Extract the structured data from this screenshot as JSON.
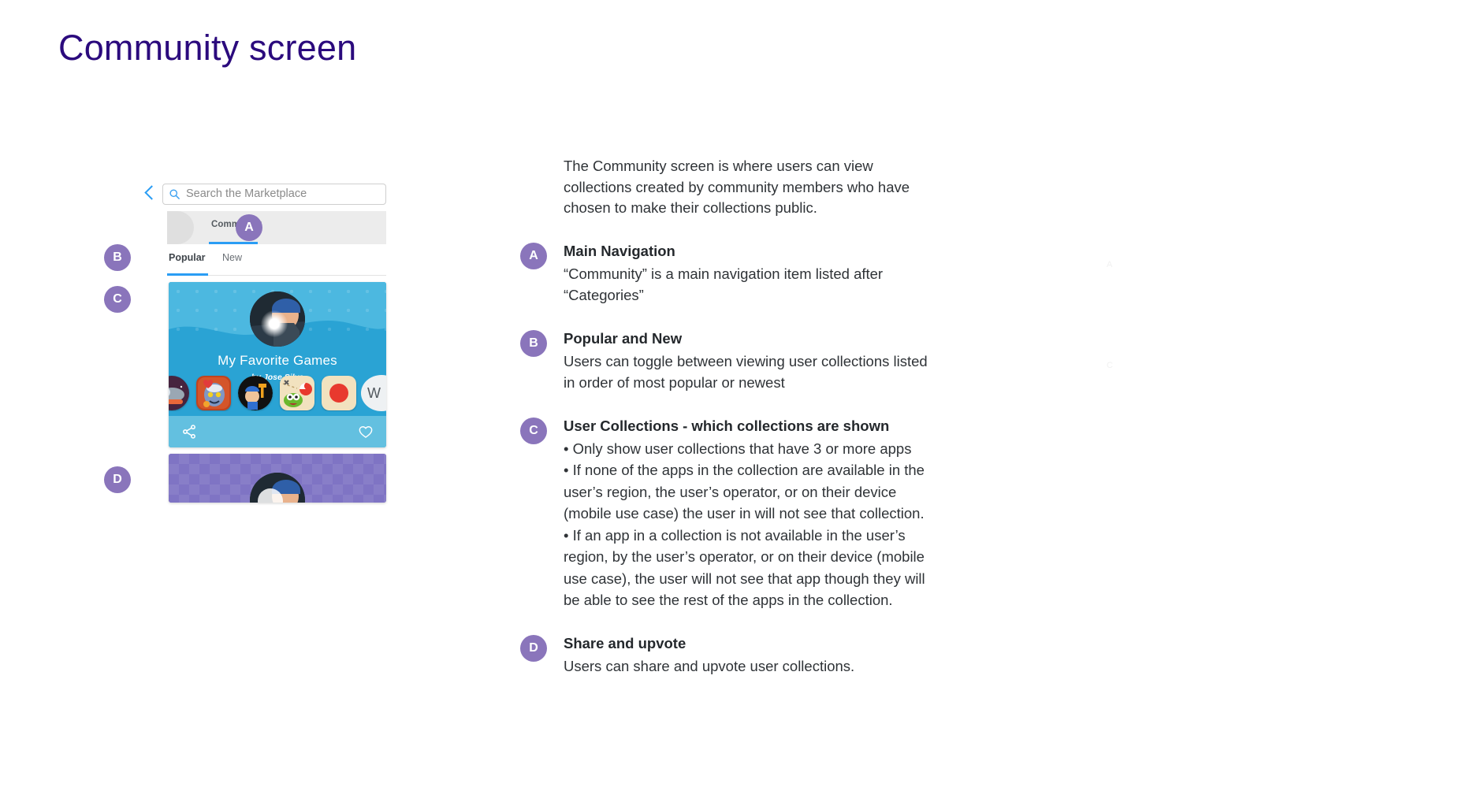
{
  "page": {
    "title": "Community screen",
    "title_color": "#2b0a7d"
  },
  "theme": {
    "badge_purple": "#8a75bb",
    "accent_blue": "#2a9df4",
    "card_blue": "#4cb8e0",
    "card_action_blue": "#63c0e0",
    "card_purple": "#7f74c4",
    "body_text": "#2f3337"
  },
  "mock": {
    "search": {
      "placeholder": "Search the Marketplace",
      "back_icon": "back-chevron-icon",
      "icon": "search-icon"
    },
    "main_nav": {
      "active_item": "Community",
      "items": [
        "Community"
      ]
    },
    "subtabs": [
      {
        "label": "Popular",
        "active": true
      },
      {
        "label": "New",
        "active": false
      }
    ],
    "collections": [
      {
        "title": "My Favorite Games",
        "byline": "by Jose Silva",
        "more_label": "W",
        "actions": {
          "share_icon": "share-icon",
          "upvote_icon": "heart-icon"
        },
        "apps": [
          {
            "name": "app-icon-1"
          },
          {
            "name": "app-icon-2"
          },
          {
            "name": "app-icon-3"
          },
          {
            "name": "app-icon-4"
          },
          {
            "name": "app-icon-5"
          }
        ]
      },
      {
        "title": "",
        "byline": ""
      }
    ],
    "badges": [
      {
        "letter": "A"
      },
      {
        "letter": "B"
      },
      {
        "letter": "C"
      },
      {
        "letter": "D"
      }
    ]
  },
  "notes": {
    "intro": "The Community screen is where users can view collections created by community members who have chosen to make their collections public.",
    "items": [
      {
        "badge": "A",
        "title": "Main Navigation",
        "body": "“Community” is a main navigation item listed after “Categories”"
      },
      {
        "badge": "B",
        "title": "Popular and New",
        "body": "Users can toggle between viewing user collections listed in order of most popular or newest"
      },
      {
        "badge": "C",
        "title": "User Collections - which collections are shown",
        "bullets": [
          "• Only show user collections that have 3 or more apps",
          "• If none of the apps in the collection are available in the user’s region, the user’s operator, or on their device (mobile use case) the user in will not see that collection.",
          "• If an app in a collection is not available in the user’s region, by the user’s operator, or on their device (mobile use case), the user will not see that app though they will be able to see the rest of the apps in the collection."
        ]
      },
      {
        "badge": "D",
        "title": "Share and upvote",
        "body": "Users can share and upvote user collections."
      }
    ]
  },
  "ghost_marks": {
    "a": "A",
    "c": "C"
  }
}
